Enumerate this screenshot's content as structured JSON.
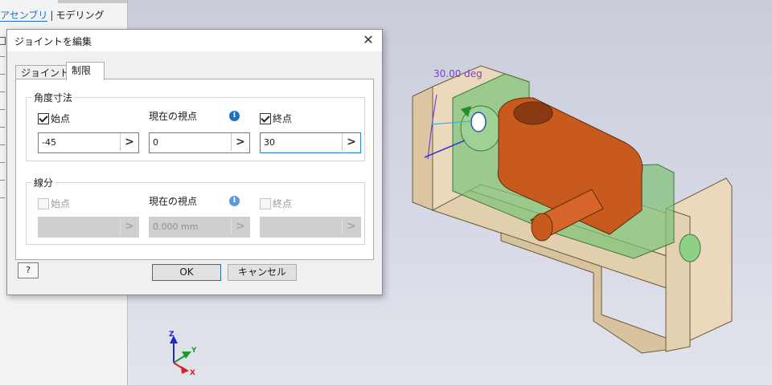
{
  "browser": {
    "tabs": [
      {
        "label": "アセンブリ",
        "active": true
      },
      {
        "label": "モデリング",
        "active": false
      }
    ],
    "separator": "|"
  },
  "viewport": {
    "dimension_label": "30.00 deg",
    "dimension_color": "#7b3fd6",
    "triad": {
      "x": "X",
      "y": "Y",
      "z": "Z"
    }
  },
  "dialog": {
    "title": "ジョイントを編集",
    "close_icon": "close-icon",
    "tabs": [
      {
        "label": "ジョイント",
        "selected": false
      },
      {
        "label": "制限",
        "selected": true
      }
    ],
    "angle_group": {
      "title": "角度寸法",
      "start": {
        "label": "始点",
        "checked": true,
        "value": "-45"
      },
      "current": {
        "label": "現在の視点",
        "value": "0"
      },
      "end": {
        "label": "終点",
        "checked": true,
        "value": "30"
      }
    },
    "linear_group": {
      "title": "線分",
      "start": {
        "label": "始点",
        "checked": false,
        "value": ""
      },
      "current": {
        "label": "現在の視点",
        "value": "0.000 mm"
      },
      "end": {
        "label": "終点",
        "checked": false,
        "value": ""
      }
    },
    "help_icon": "help-icon",
    "help_label": "?",
    "ok_label": "OK",
    "cancel_label": "キャンセル",
    "arrow_glyph": ">",
    "info_glyph": "i"
  },
  "colors": {
    "accent": "#1f70c1",
    "part_orange": "#c85a1e",
    "part_green": "#7ec27a",
    "part_tan": "#ead9bd"
  }
}
